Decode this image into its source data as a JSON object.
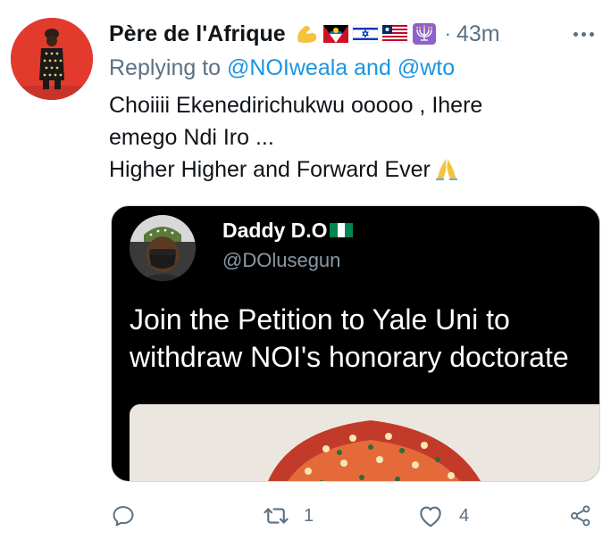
{
  "tweet": {
    "author_name": "Père de l'Afrique",
    "name_emojis": [
      "flexed-biceps-emoji",
      "antigua-barbuda-flag-emoji",
      "israel-flag-emoji",
      "liberia-flag-emoji",
      "menorah-emoji"
    ],
    "separator": "·",
    "timestamp": "43m",
    "replying_prefix": "Replying to",
    "replying_mention_1": "@NOIweala",
    "replying_conjunction": "and",
    "replying_mention_2": "@wto",
    "text_line_1": "Choiiii Ekenedirichukwu ooooo , Ihere",
    "text_line_2": "emego Ndi Iro ...",
    "text_line_3": "Higher Higher and Forward Ever",
    "trailing_emoji": "folded-hands-emoji"
  },
  "media": {
    "quoted_name": "Daddy D.O",
    "quoted_flag": "nigeria-flag-emoji",
    "quoted_handle": "@DOlusegun",
    "quoted_line_1": "Join the Petition to Yale Uni to",
    "quoted_line_2": "withdraw NOI's honorary doctorate"
  },
  "actions": {
    "reply_count": "",
    "retweet_count": "1",
    "like_count": "4",
    "icons": [
      "reply-icon",
      "retweet-icon",
      "like-icon",
      "share-icon"
    ]
  },
  "colors": {
    "text": "#0f1419",
    "secondary": "#5b7083",
    "link": "#1b95e0",
    "avatar_bg": "#e23b2e"
  }
}
